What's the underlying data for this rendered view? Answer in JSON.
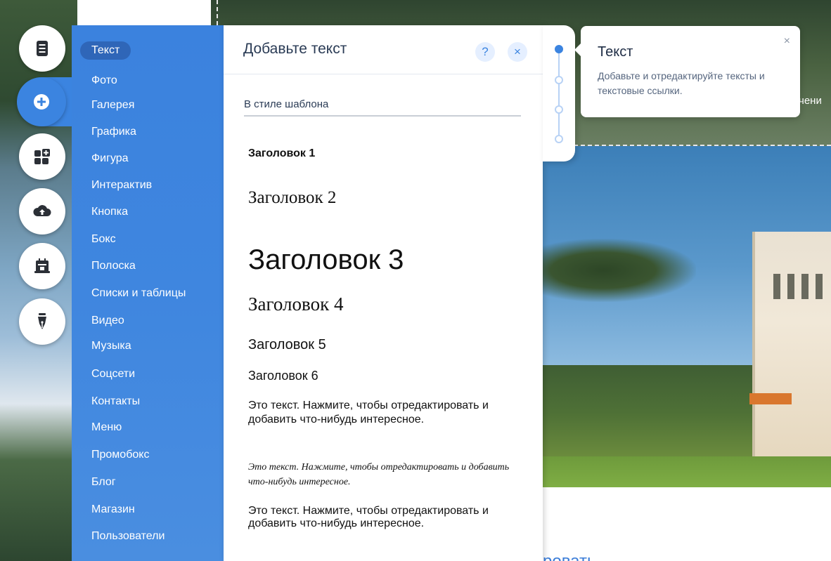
{
  "rail": {
    "buttons": [
      {
        "icon": "pages-icon"
      },
      {
        "icon": "add-icon"
      },
      {
        "icon": "add-apps-icon"
      },
      {
        "icon": "upload-cloud-icon"
      },
      {
        "icon": "business-icon"
      },
      {
        "icon": "pen-icon"
      }
    ]
  },
  "categories": {
    "items": [
      {
        "label": "Текст",
        "selected": true
      },
      {
        "label": "Фото"
      },
      {
        "label": "Галерея"
      },
      {
        "label": "Графика"
      },
      {
        "label": "Фигура"
      },
      {
        "label": "Интерактив"
      },
      {
        "label": "Кнопка"
      },
      {
        "label": "Бокс"
      },
      {
        "label": "Полоска"
      },
      {
        "label": "Списки и таблицы"
      },
      {
        "label": "Видео"
      },
      {
        "label": "Музыка"
      },
      {
        "label": "Соцсети"
      },
      {
        "label": "Контакты"
      },
      {
        "label": "Меню"
      },
      {
        "label": "Промобокс"
      },
      {
        "label": "Блог"
      },
      {
        "label": "Магазин"
      },
      {
        "label": "Пользователи"
      }
    ]
  },
  "panel": {
    "title": "Добавьте текст",
    "help_label": "?",
    "close_label": "×",
    "section_label": "В стиле шаблона",
    "samples": {
      "h1": "Заголовок 1",
      "h2": "Заголовок 2",
      "h3": "Заголовок 3",
      "h4": "Заголовок 4",
      "h5": "Заголовок 5",
      "h6": "Заголовок 6",
      "p1": "Это текст. Нажмите, чтобы отредактировать и добавить что-нибудь интересное.",
      "p2": "Это текст. Нажмите, чтобы отредактировать и добавить что-нибудь интересное.",
      "p3": "Это текст. Нажмите, чтобы отредактировать и добавить что-нибудь интересное."
    }
  },
  "tooltip": {
    "title": "Текст",
    "body": "Добавьте и отредактируйте тексты и текстовые ссылки.",
    "close_label": "×"
  },
  "stepper": {
    "steps": 4,
    "current": 1
  },
  "background": {
    "peek_top": "чени",
    "peek_bottom": "ровать"
  },
  "colors": {
    "accent": "#3b84e0",
    "category_selected": "#2f66b8",
    "panel_text": "#2a3b55"
  }
}
